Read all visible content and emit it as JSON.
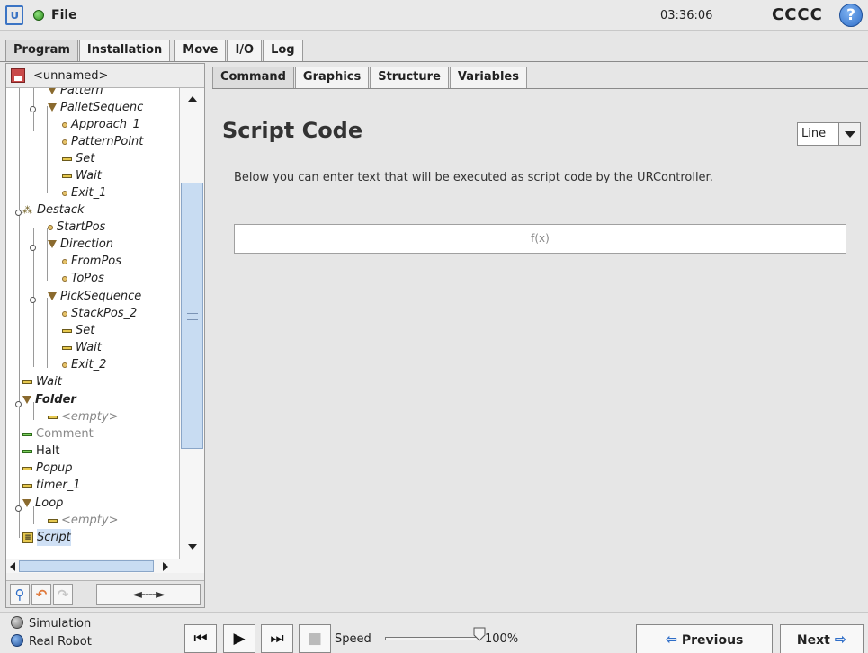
{
  "header": {
    "file_label": "File",
    "clock": "03:36:06",
    "robot_name": "CCCC",
    "help_symbol": "?"
  },
  "main_tabs": [
    "Program",
    "Installation",
    "Move",
    "I/O",
    "Log"
  ],
  "program": {
    "name": "<unnamed>"
  },
  "tree": [
    {
      "label": "Pattern",
      "marker": "triangle"
    },
    {
      "label": "PalletSequenc",
      "marker": "triangle"
    },
    {
      "label": "Approach_1",
      "marker": "dot"
    },
    {
      "label": "PatternPoint",
      "marker": "dot"
    },
    {
      "label": "Set",
      "marker": "bar"
    },
    {
      "label": "Wait",
      "marker": "bar"
    },
    {
      "label": "Exit_1",
      "marker": "dot"
    },
    {
      "label": "Destack",
      "marker": "stack"
    },
    {
      "label": "StartPos",
      "marker": "dot"
    },
    {
      "label": "Direction",
      "marker": "triangle"
    },
    {
      "label": "FromPos",
      "marker": "dot"
    },
    {
      "label": "ToPos",
      "marker": "dot"
    },
    {
      "label": "PickSequence",
      "marker": "triangle"
    },
    {
      "label": "StackPos_2",
      "marker": "dot"
    },
    {
      "label": "Set",
      "marker": "bar"
    },
    {
      "label": "Wait",
      "marker": "bar"
    },
    {
      "label": "Exit_2",
      "marker": "dot"
    },
    {
      "label": "Wait",
      "marker": "bar"
    },
    {
      "label": "Folder",
      "marker": "triangle"
    },
    {
      "label": "<empty>",
      "marker": "bar"
    },
    {
      "label": "Comment",
      "marker": "bar-green"
    },
    {
      "label": "Halt",
      "marker": "bar-green"
    },
    {
      "label": "Popup",
      "marker": "bar"
    },
    {
      "label": "timer_1",
      "marker": "bar"
    },
    {
      "label": "Loop",
      "marker": "triangle"
    },
    {
      "label": "<empty>",
      "marker": "bar"
    },
    {
      "label": "Script",
      "marker": "script",
      "selected": true
    }
  ],
  "tree_toolbar": {
    "search_icon": "search-icon",
    "undo_icon": "undo-icon",
    "redo_icon": "redo-icon",
    "move_arrows": "◄----►"
  },
  "content_tabs": [
    "Command",
    "Graphics",
    "Structure",
    "Variables"
  ],
  "command": {
    "title": "Script Code",
    "mode_value": "Line",
    "description": "Below you can enter text that will be executed as script code by the URController.",
    "expression": "f(x)"
  },
  "footer": {
    "simulation_label": "Simulation",
    "real_robot_label": "Real Robot",
    "speed_label": "Speed",
    "speed_value": "100%",
    "speed_fraction": 1.0,
    "previous_label": "Previous",
    "next_label": "Next"
  },
  "colors": {
    "accent": "#2f6ec8",
    "status_ok": "#3fa82b",
    "selection": "#cfe0f5",
    "scroll_thumb": "#c8dcf2"
  }
}
